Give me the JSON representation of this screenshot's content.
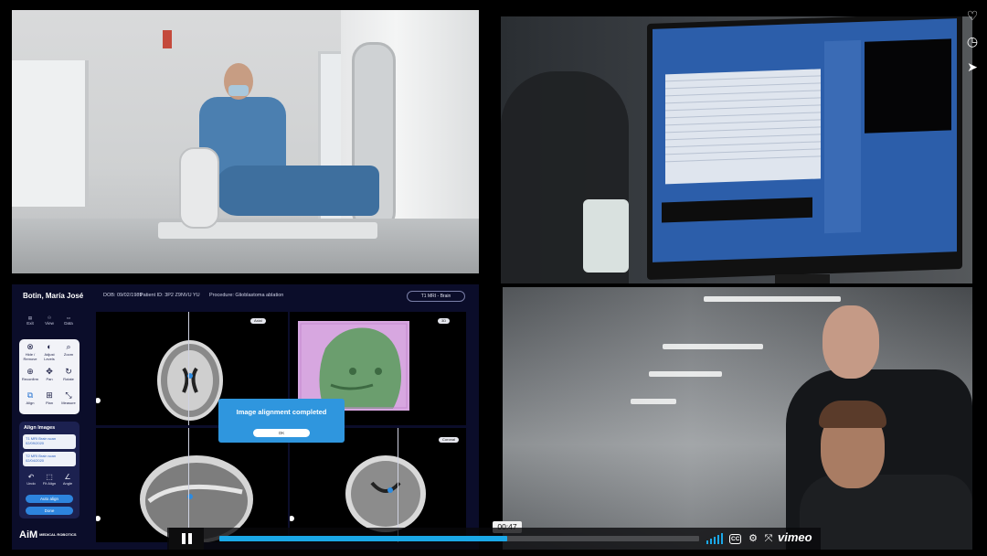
{
  "app": {
    "patient_name": "Botin, María José",
    "dob": "DOB: 09/02/1989",
    "patient_id": "Patient ID: 3P2 Z9NVU YU",
    "procedure": "Procedure: Glioblastoma ablation",
    "series_select": "T1 MRI - Brain",
    "nav": [
      "Exit",
      "View",
      "Data"
    ],
    "tools": [
      {
        "label": "Hide / Remove",
        "icon": "hide-icon",
        "glyph": "⊗"
      },
      {
        "label": "Adjust Levels",
        "icon": "contrast-icon",
        "glyph": "◐"
      },
      {
        "label": "Zoom",
        "icon": "zoom-icon",
        "glyph": "⌕"
      },
      {
        "label": "Reconfirm",
        "icon": "recenter-icon",
        "glyph": "⊕"
      },
      {
        "label": "Pan",
        "icon": "pan-icon",
        "glyph": "✥"
      },
      {
        "label": "Rotate",
        "icon": "rotate-icon",
        "glyph": "↻"
      },
      {
        "label": "Align",
        "icon": "align-icon",
        "glyph": "⧉"
      },
      {
        "label": "Plan",
        "icon": "plan-icon",
        "glyph": "⊞"
      },
      {
        "label": "Measure",
        "icon": "measure-icon",
        "glyph": "⤡"
      }
    ],
    "align_title": "Align Images",
    "scans": [
      {
        "name": "T1 MRI Brain scan",
        "date": "02/09/2020"
      },
      {
        "name": "T2 MRI Brain scan",
        "date": "02/04/2020"
      }
    ],
    "mini_tools": [
      {
        "label": "Undo",
        "glyph": "↶"
      },
      {
        "label": "Fit Align",
        "glyph": "⬚"
      },
      {
        "label": "Angle",
        "glyph": "∠"
      }
    ],
    "auto_align": "Auto align",
    "done": "Done",
    "viewport_labels": [
      "Axial",
      "3D",
      "Coronal"
    ],
    "modal_title": "Image alignment completed",
    "modal_ok": "OK",
    "logo": "AiM",
    "logo_sub": "MEDICAL ROBOTICS"
  },
  "player": {
    "time": "00:47",
    "progress": 0.6,
    "brand": "vimeo",
    "cc": "CC"
  },
  "side_icons": [
    "heart-icon",
    "clock-icon",
    "share-icon"
  ],
  "colors": {
    "accent": "#1ba8e8",
    "app_bg": "#0b0d2a",
    "modal": "#2f96de"
  }
}
